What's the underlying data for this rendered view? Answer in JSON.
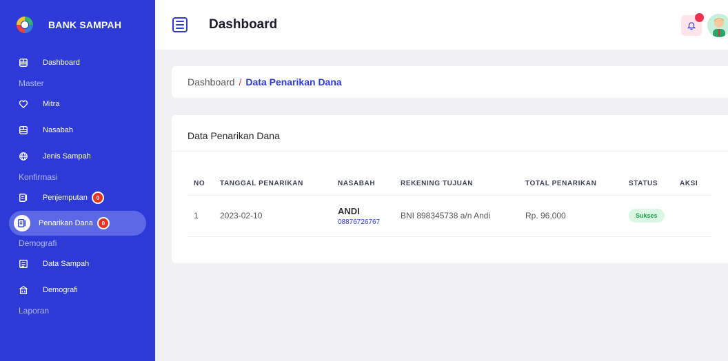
{
  "app": {
    "brand": "BANK SAMPAH"
  },
  "header": {
    "title": "Dashboard"
  },
  "sidebar": {
    "items": [
      {
        "type": "item",
        "label": "Dashboard",
        "icon": "dashboard-icon"
      },
      {
        "type": "section",
        "label": "Master"
      },
      {
        "type": "item",
        "label": "Mitra",
        "icon": "heart-icon"
      },
      {
        "type": "item",
        "label": "Nasabah",
        "icon": "dashboard-icon"
      },
      {
        "type": "item",
        "label": "Jenis Sampah",
        "icon": "globe-icon"
      },
      {
        "type": "section",
        "label": "Konfirmasi"
      },
      {
        "type": "item",
        "label": "Penjemputan",
        "icon": "clipboard-icon",
        "badge": "0"
      },
      {
        "type": "item",
        "label": "Penarikan Dana",
        "icon": "clipboard-icon",
        "badge": "0",
        "active": true
      },
      {
        "type": "section",
        "label": "Demografi"
      },
      {
        "type": "item",
        "label": "Data Sampah",
        "icon": "list-icon"
      },
      {
        "type": "item",
        "label": "Demografi",
        "icon": "building-icon"
      },
      {
        "type": "section",
        "label": "Laporan"
      }
    ]
  },
  "breadcrumb": {
    "home": "Dashboard",
    "separator": "/",
    "current": "Data Penarikan Dana"
  },
  "table": {
    "title": "Data Penarikan Dana",
    "columns": [
      "NO",
      "TANGGAL PENARIKAN",
      "NASABAH",
      "REKENING TUJUAN",
      "TOTAL PENARIKAN",
      "STATUS",
      "AKSI"
    ],
    "rows": [
      {
        "no": "1",
        "date": "2023-02-10",
        "name": "ANDI",
        "phone": "08876726767",
        "account": "BNI 898345738 a/n Andi",
        "total": "Rp. 96,000",
        "status": "Sukses",
        "action": ""
      }
    ]
  },
  "colors": {
    "sidebar": "#2d3ad8",
    "accent": "#2d3ad8",
    "badge": "#e8321f",
    "success": "#1f9e4e"
  }
}
